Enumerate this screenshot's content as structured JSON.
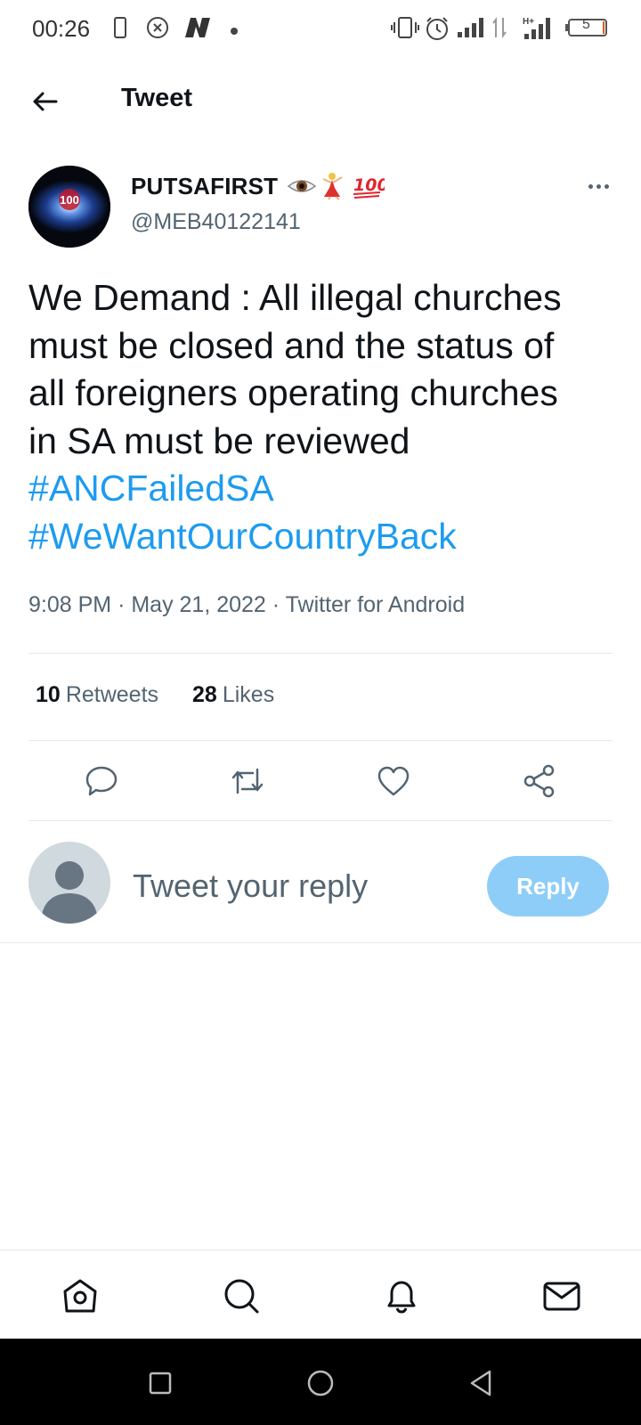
{
  "status_bar": {
    "time": "00:26",
    "battery_level": "5",
    "icons": [
      "phone-outline-icon",
      "close-circle-icon",
      "news-app-icon",
      "dot-icon",
      "vibrate-icon",
      "alarm-icon",
      "signal-icon",
      "data-arrows-icon",
      "hplus-signal-icon",
      "battery-icon"
    ]
  },
  "header": {
    "title": "Tweet"
  },
  "tweet": {
    "author_name": "PUTSAFIRST",
    "name_emojis": "👁️💃💯",
    "author_handle": "@MEB40122141",
    "text_lines": [
      "We Demand :  All illegal churches",
      "must be closed and the status of",
      "all foreigners operating churches",
      "in SA must be reviewed"
    ],
    "hashtags": [
      "#ANCFailedSA",
      "#WeWantOurCountryBack"
    ],
    "time": "9:08 PM",
    "separator": "·",
    "date": "May 21, 2022",
    "source": "Twitter for Android",
    "retweets_count": "10",
    "retweets_label": "Retweets",
    "likes_count": "28",
    "likes_label": "Likes"
  },
  "composer": {
    "placeholder": "Tweet your reply",
    "reply_button": "Reply"
  },
  "colors": {
    "accent": "#1d9bf0",
    "reply_button_disabled": "#8ecdf8",
    "secondary_text": "#536471",
    "divider": "#e7e9ea"
  },
  "bottom_nav": [
    "home-icon",
    "search-icon",
    "notifications-icon",
    "messages-icon"
  ],
  "system_nav": [
    "recents-icon",
    "home-circle-icon",
    "back-triangle-icon"
  ]
}
